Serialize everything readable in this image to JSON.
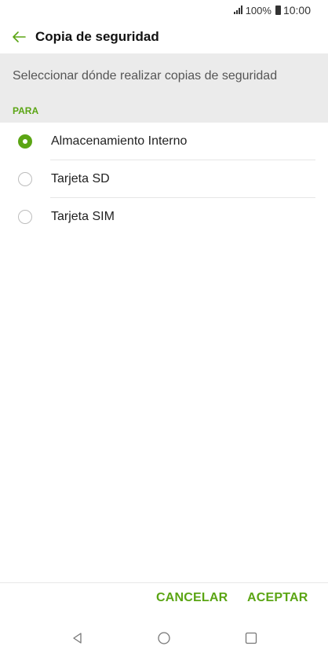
{
  "status_bar": {
    "battery": "100%",
    "time": "10:00"
  },
  "app_bar": {
    "title": "Copia de seguridad"
  },
  "banner": {
    "text": "Seleccionar dónde realizar copias de seguridad"
  },
  "section": {
    "header": "PARA"
  },
  "options": [
    {
      "label": "Almacenamiento Interno",
      "selected": true
    },
    {
      "label": "Tarjeta SD",
      "selected": false
    },
    {
      "label": "Tarjeta SIM",
      "selected": false
    }
  ],
  "actions": {
    "cancel": "CANCELAR",
    "accept": "ACEPTAR"
  },
  "colors": {
    "accent": "#5ba514",
    "banner_bg": "#ebebeb"
  }
}
